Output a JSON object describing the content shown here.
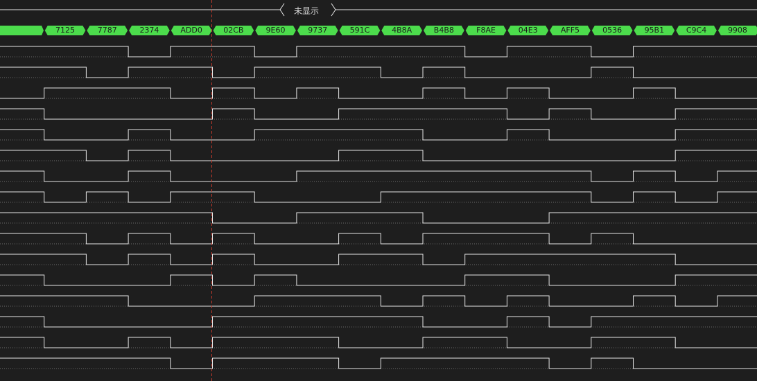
{
  "header": {
    "hidden_label": "未显示"
  },
  "colors": {
    "background": "#1e1e1e",
    "bus_fill": "#4cdc4c",
    "bus_text": "#1b1b1b",
    "trace": "#e6e6e6",
    "cursor": "#c0392b"
  },
  "bus": {
    "values": [
      "7125",
      "7787",
      "2374",
      "ADD0",
      "02CB",
      "9E60",
      "9737",
      "591C",
      "4B8A",
      "B4B8",
      "F8AE",
      "04E3",
      "AFF5",
      "0536",
      "95B1",
      "C9C4",
      "9908"
    ]
  },
  "cursor": {
    "label": "cursor-line"
  },
  "channels": [
    {
      "initial": 1,
      "transitions": [
        3,
        4,
        6,
        7,
        11,
        12,
        14,
        15
      ]
    },
    {
      "initial": 1,
      "transitions": [
        2,
        3,
        5,
        6,
        9,
        10,
        11,
        14,
        15
      ]
    },
    {
      "initial": 0,
      "transitions": [
        1,
        4,
        5,
        6,
        7,
        8,
        10,
        11,
        12,
        13,
        15,
        16
      ]
    },
    {
      "initial": 1,
      "transitions": [
        1,
        5,
        6,
        8,
        12,
        13,
        14,
        16
      ]
    },
    {
      "initial": 1,
      "transitions": [
        1,
        3,
        4,
        6,
        10,
        12,
        13,
        16
      ]
    },
    {
      "initial": 1,
      "transitions": [
        2,
        3,
        4,
        8,
        10,
        16
      ]
    },
    {
      "initial": 1,
      "transitions": [
        1,
        3,
        4,
        7,
        14,
        15,
        16,
        17
      ]
    },
    {
      "initial": 1,
      "transitions": [
        1,
        2,
        3,
        4,
        6,
        9,
        14,
        15,
        16,
        17
      ]
    },
    {
      "initial": 1,
      "transitions": [
        5,
        7,
        10,
        13
      ]
    },
    {
      "initial": 1,
      "transitions": [
        2,
        3,
        4,
        5,
        6,
        8,
        9,
        10,
        13,
        14,
        15
      ]
    },
    {
      "initial": 1,
      "transitions": [
        2,
        3,
        4,
        5,
        6,
        8,
        10,
        11,
        16
      ]
    },
    {
      "initial": 1,
      "transitions": [
        1,
        4,
        5,
        6,
        7,
        11,
        13,
        16
      ]
    },
    {
      "initial": 1,
      "transitions": [
        3,
        6,
        9,
        10,
        11,
        12,
        13,
        15,
        16,
        17
      ]
    },
    {
      "initial": 1,
      "transitions": [
        1,
        5,
        10,
        12,
        13,
        14
      ]
    },
    {
      "initial": 1,
      "transitions": [
        1,
        3,
        4,
        5,
        8,
        10,
        12,
        14,
        16
      ]
    },
    {
      "initial": 1,
      "transitions": [
        4,
        5,
        8,
        9,
        13,
        14,
        15
      ]
    }
  ]
}
